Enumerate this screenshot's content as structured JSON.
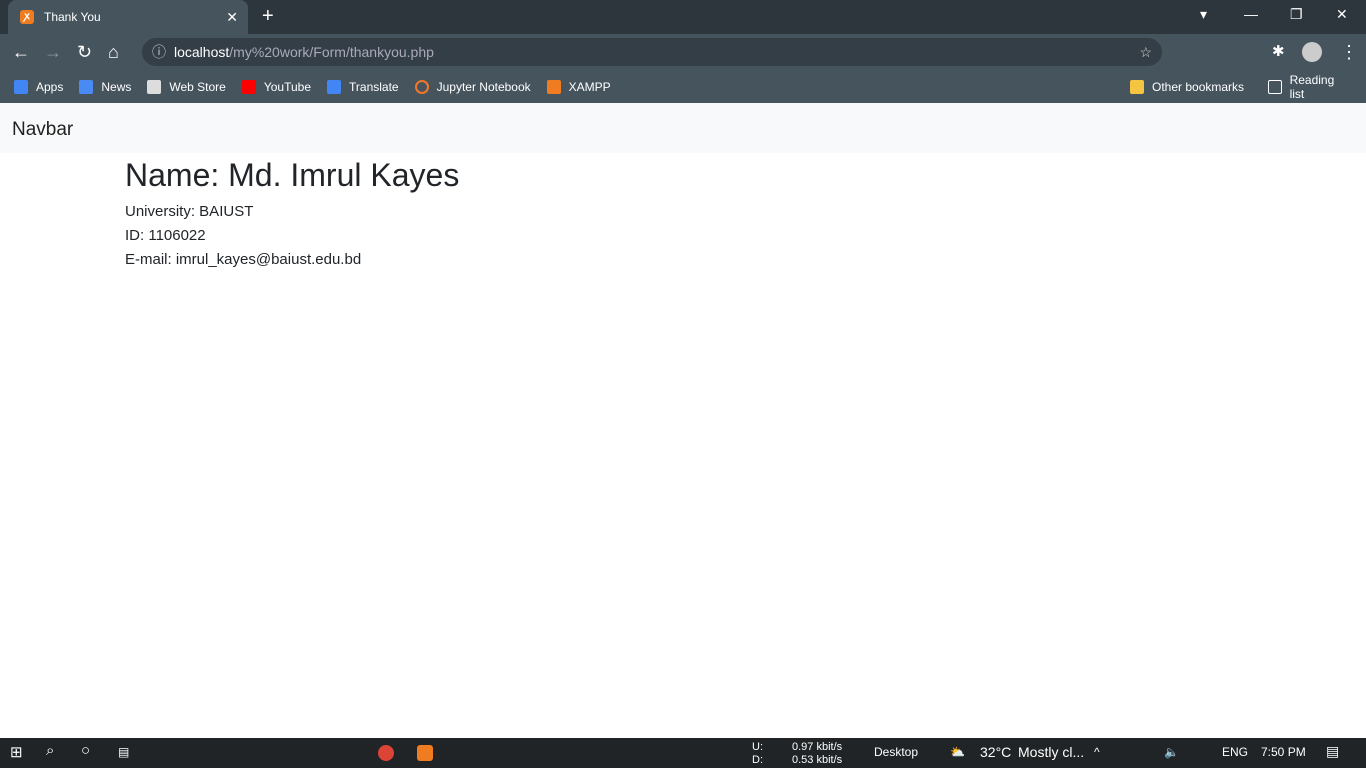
{
  "browser": {
    "tab_title": "Thank You",
    "url_host": "localhost",
    "url_path": "/my%20work/Form/thankyou.php",
    "bookmarks": [
      {
        "label": "Apps",
        "color": "#4285f4"
      },
      {
        "label": "News",
        "color": "#4a8af4"
      },
      {
        "label": "Web Store",
        "color": "#ddd"
      },
      {
        "label": "YouTube",
        "color": "#f00"
      },
      {
        "label": "Translate",
        "color": "#4285f4"
      },
      {
        "label": "Jupyter Notebook",
        "color": "#f37726"
      },
      {
        "label": "XAMPP",
        "color": "#f07c22"
      }
    ],
    "other_bookmarks": "Other bookmarks",
    "reading_list": "Reading list"
  },
  "page": {
    "navbar_brand": "Navbar",
    "name": "Name: Md. Imrul Kayes",
    "university": "University: BAIUST",
    "id": "ID: 1106022",
    "email": "E-mail: imrul_kayes@baiust.edu.bd"
  },
  "taskbar": {
    "up_label": "U:",
    "down_label": "D:",
    "up_speed": "0.97 kbit/s",
    "down_speed": "0.53 kbit/s",
    "desktop": "Desktop",
    "temp": "32°C",
    "weather": "Mostly cl...",
    "lang": "ENG",
    "time": "7:50 PM"
  }
}
